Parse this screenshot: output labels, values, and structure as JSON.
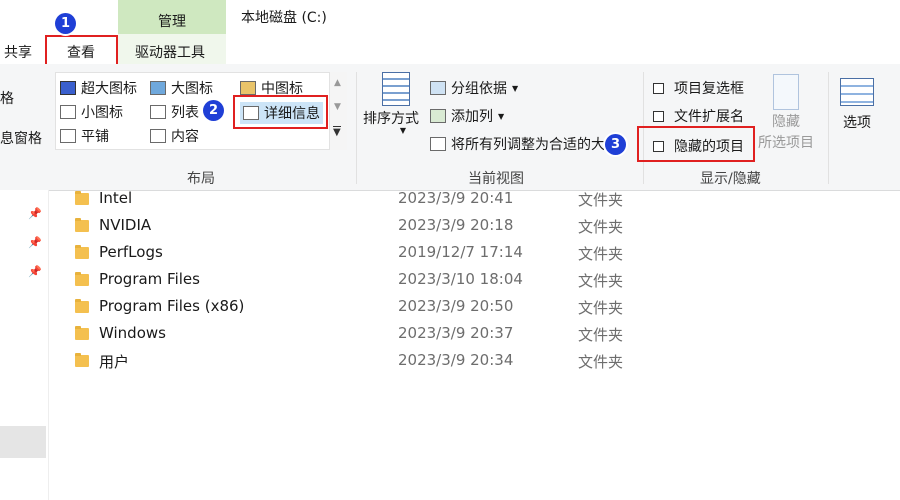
{
  "tabs": {
    "share": "共享",
    "view": "查看",
    "manage": "管理",
    "drive_tools": "驱动器工具"
  },
  "window_title": "本地磁盘 (C:)",
  "left_cut": {
    "item1": "格",
    "item2": "息窗格"
  },
  "layout_group": {
    "label": "布局",
    "items": {
      "extra_large": "超大图标",
      "large": "大图标",
      "medium": "中图标",
      "small": "小图标",
      "list": "列表",
      "details": "详细信息",
      "tiles": "平铺",
      "content": "内容"
    }
  },
  "current_view_group": {
    "label": "当前视图",
    "sort_by": "排序方式",
    "group_by": "分组依据",
    "add_column": "添加列",
    "fit_columns": "将所有列调整为合适的大小"
  },
  "show_hide_group": {
    "label": "显示/隐藏",
    "item_checkboxes": "项目复选框",
    "file_extensions": "文件扩展名",
    "hidden_items": "隐藏的项目",
    "hide_selected_line1": "隐藏",
    "hide_selected_line2": "所选项目"
  },
  "options": "选项",
  "badges": [
    "1",
    "2",
    "3"
  ],
  "files": [
    {
      "name": "Intel",
      "date": "2023/3/9 20:41",
      "type": "文件夹"
    },
    {
      "name": "NVIDIA",
      "date": "2023/3/9 20:18",
      "type": "文件夹"
    },
    {
      "name": "PerfLogs",
      "date": "2019/12/7 17:14",
      "type": "文件夹"
    },
    {
      "name": "Program Files",
      "date": "2023/3/10 18:04",
      "type": "文件夹"
    },
    {
      "name": "Program Files (x86)",
      "date": "2023/3/9 20:50",
      "type": "文件夹"
    },
    {
      "name": "Windows",
      "date": "2023/3/9 20:37",
      "type": "文件夹"
    },
    {
      "name": "用户",
      "date": "2023/3/9 20:34",
      "type": "文件夹"
    }
  ],
  "colors": {
    "manage_tab": "#cfe8c0",
    "highlight": "#e02020",
    "badge": "#1f3fd6",
    "folder": "#f4c04f"
  }
}
